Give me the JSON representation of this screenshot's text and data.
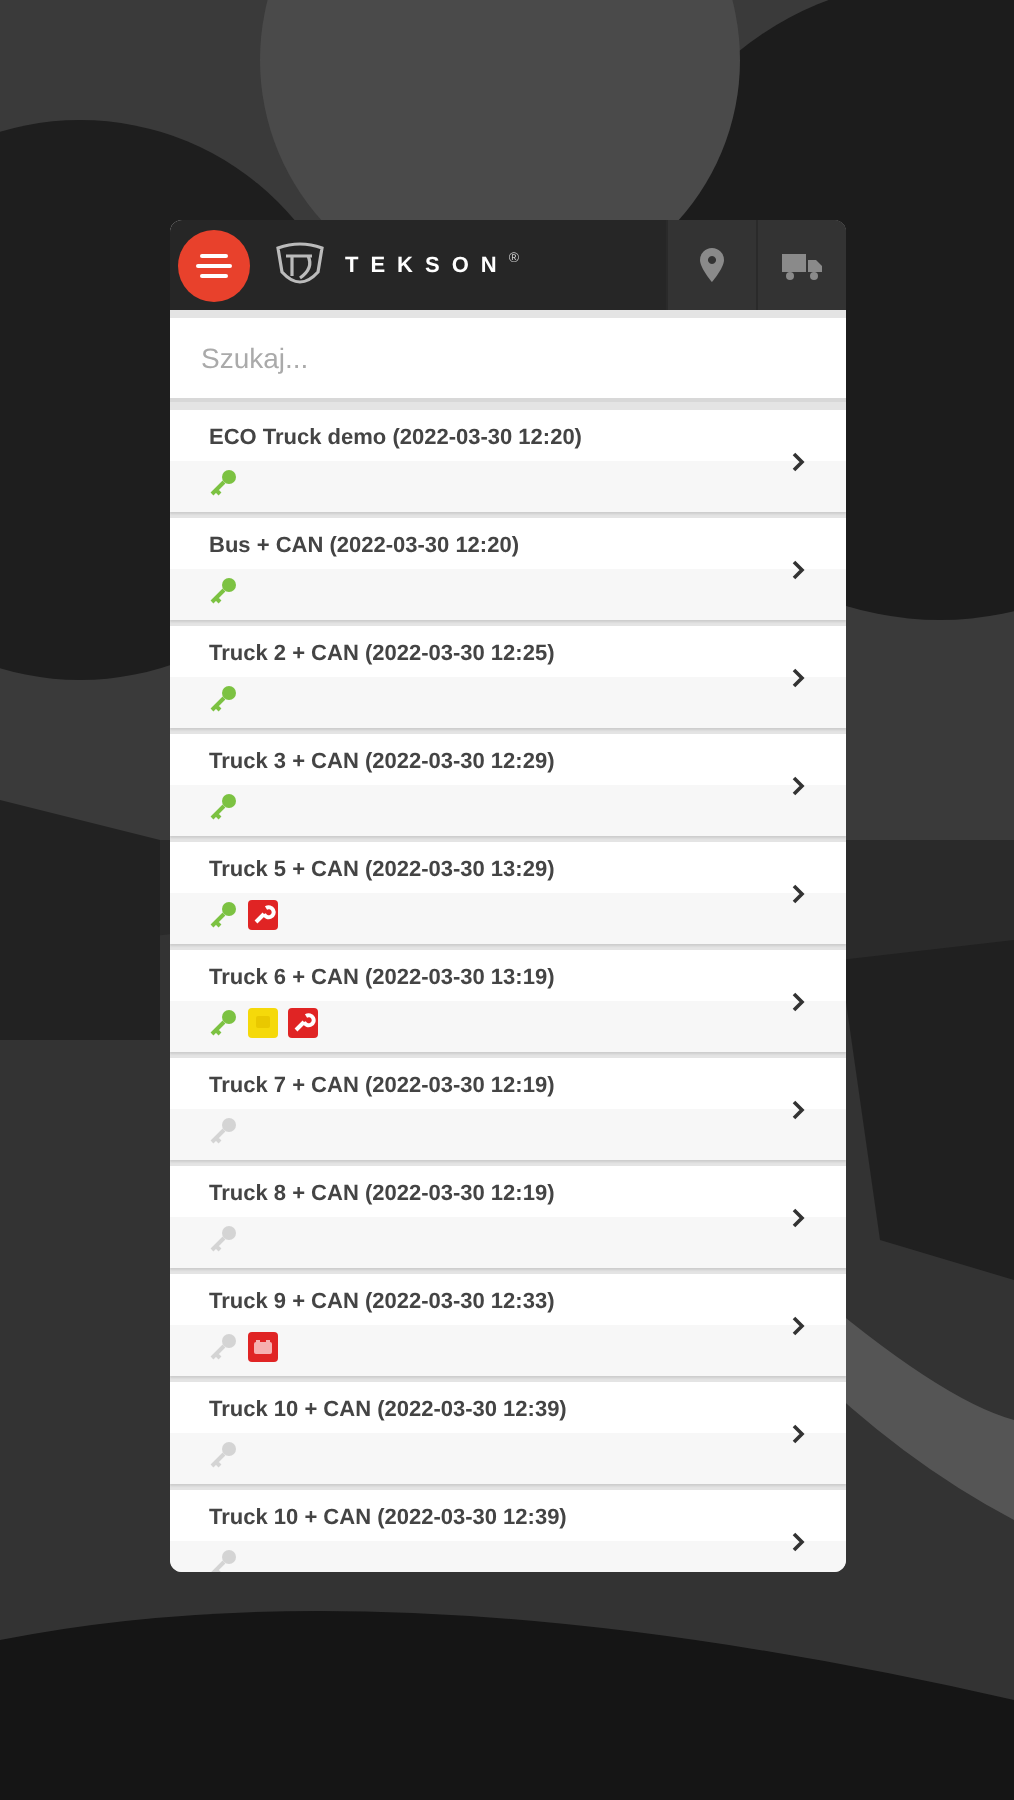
{
  "header": {
    "brand": "TEKSON",
    "registered": "®",
    "tabs": [
      {
        "kind": "map",
        "selected": false
      },
      {
        "kind": "vehicles",
        "selected": false
      }
    ]
  },
  "search": {
    "placeholder": "Szukaj..."
  },
  "vehicles": [
    {
      "title": "ECO Truck demo (2022-03-30 12:20)",
      "ignition": true
    },
    {
      "title": "Bus + CAN (2022-03-30 12:20)",
      "ignition": true
    },
    {
      "title": "Truck 2 + CAN (2022-03-30 12:25)",
      "ignition": true
    },
    {
      "title": "Truck 3 + CAN (2022-03-30 12:29)",
      "ignition": true
    },
    {
      "title": "Truck 5 + CAN (2022-03-30 13:29)",
      "ignition": true,
      "alerts": [
        {
          "kind": "service"
        }
      ]
    },
    {
      "title": "Truck 6 + CAN (2022-03-30 13:19)",
      "ignition": true,
      "alerts": [
        {
          "kind": "fuel"
        },
        {
          "kind": "service"
        }
      ]
    },
    {
      "title": "Truck 7 + CAN (2022-03-30 12:19)",
      "ignition": false
    },
    {
      "title": "Truck 8 + CAN (2022-03-30 12:19)",
      "ignition": false
    },
    {
      "title": "Truck 9 + CAN (2022-03-30 12:33)",
      "ignition": false,
      "alerts": [
        {
          "kind": "battery"
        }
      ]
    },
    {
      "title": "Truck 10 + CAN (2022-03-30 12:39)",
      "ignition": false
    },
    {
      "title": "Truck 10 + CAN (2022-03-30 12:39)",
      "ignition": false
    }
  ]
}
